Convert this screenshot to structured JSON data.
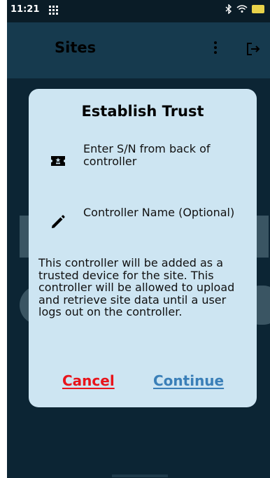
{
  "status_bar": {
    "time": "11:21",
    "grid_icon": "app-grid-icon",
    "bluetooth_icon": "bluetooth-icon",
    "wifi_icon": "wifi-icon",
    "battery_icon": "battery-icon"
  },
  "app_bar": {
    "title": "Sites",
    "menu_icon": "more-vert-icon",
    "logout_icon": "logout-icon"
  },
  "dialog": {
    "title": "Establish Trust",
    "serial_label": "Enter S/N from back of controller",
    "serial_icon": "ticket-icon",
    "name_label": "Controller Name (Optional)",
    "name_icon": "pencil-icon",
    "description": "This controller will be added as a trusted device for the site. This controller will be allowed to upload and retrieve site data until a user logs out on the controller.",
    "cancel_label": "Cancel",
    "continue_label": "Continue"
  },
  "colors": {
    "dialog_bg": "#cde5f2",
    "cancel": "#e8141b",
    "continue": "#3a7fb8",
    "scrim": "#0c2534"
  }
}
